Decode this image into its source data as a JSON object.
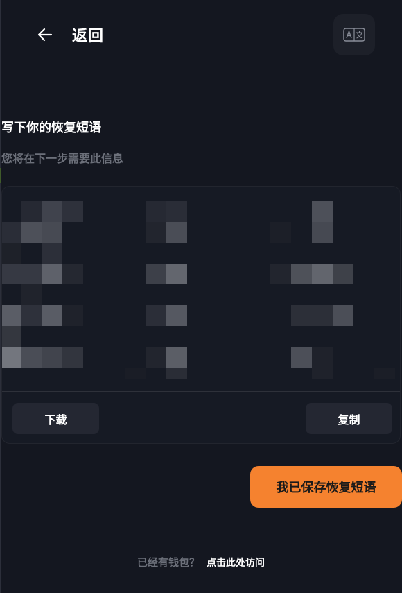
{
  "header": {
    "back_label": "返回",
    "back_icon": "arrow-left-icon",
    "translate_icon": "translate-icon"
  },
  "content": {
    "title": "写下你的恢复短语",
    "subtitle": "您将在下一步需要此信息"
  },
  "phrase_card": {
    "words_blurred": true,
    "download_label": "下载",
    "copy_label": "复制"
  },
  "primary_button": {
    "label": "我已保存恢复短语"
  },
  "footer": {
    "prompt": "已经有钱包？",
    "link_label": "点击此处访问"
  },
  "colors": {
    "background": "#141720",
    "card": "#161a24",
    "secondary_button": "#242732",
    "accent": "#f5822f",
    "muted_text": "#6c707a"
  }
}
